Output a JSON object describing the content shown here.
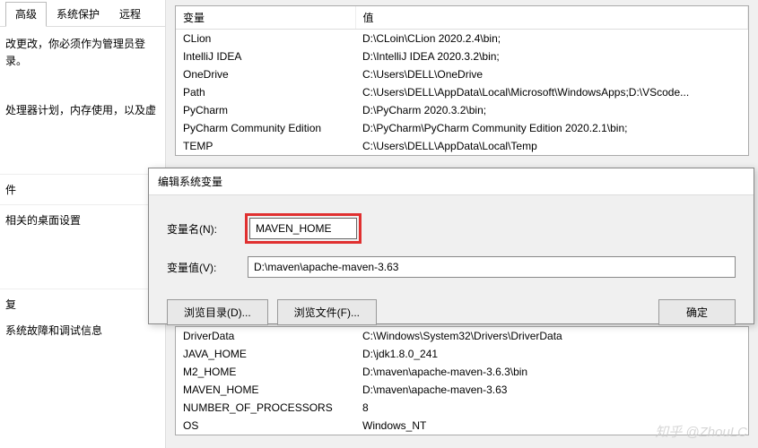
{
  "left": {
    "tabs": [
      "高级",
      "系统保护",
      "远程"
    ],
    "adminNote": "改更改，你必须作为管理员登录。",
    "perfNote": "处理器计划，内存使用，以及虚",
    "section1": "件",
    "section2": "相关的桌面设置",
    "section3": "复",
    "section3b": "系统故障和调试信息"
  },
  "envTable": {
    "headers": [
      "变量",
      "值"
    ],
    "rows": [
      [
        "CLion",
        "D:\\CLoin\\CLion 2020.2.4\\bin;"
      ],
      [
        "IntelliJ IDEA",
        "D:\\IntelliJ IDEA 2020.3.2\\bin;"
      ],
      [
        "OneDrive",
        "C:\\Users\\DELL\\OneDrive"
      ],
      [
        "Path",
        "C:\\Users\\DELL\\AppData\\Local\\Microsoft\\WindowsApps;D:\\VScode..."
      ],
      [
        "PyCharm",
        "D:\\PyCharm 2020.3.2\\bin;"
      ],
      [
        "PyCharm Community Edition",
        "D:\\PyCharm\\PyCharm Community Edition 2020.2.1\\bin;"
      ],
      [
        "TEMP",
        "C:\\Users\\DELL\\AppData\\Local\\Temp"
      ]
    ]
  },
  "dialog": {
    "title": "编辑系统变量",
    "nameLabel": "变量名(N):",
    "nameValue": "MAVEN_HOME",
    "valueLabel": "变量值(V):",
    "valueValue": "D:\\maven\\apache-maven-3.63",
    "browseDir": "浏览目录(D)...",
    "browseFile": "浏览文件(F)...",
    "ok": "确定"
  },
  "sysTable": {
    "rows": [
      [
        "DriverData",
        "C:\\Windows\\System32\\Drivers\\DriverData"
      ],
      [
        "JAVA_HOME",
        "D:\\jdk1.8.0_241"
      ],
      [
        "M2_HOME",
        "D:\\maven\\apache-maven-3.6.3\\bin"
      ],
      [
        "MAVEN_HOME",
        "D:\\maven\\apache-maven-3.63"
      ],
      [
        "NUMBER_OF_PROCESSORS",
        "8"
      ],
      [
        "OS",
        "Windows_NT"
      ]
    ]
  },
  "watermark": "知乎 @ZhouLC"
}
